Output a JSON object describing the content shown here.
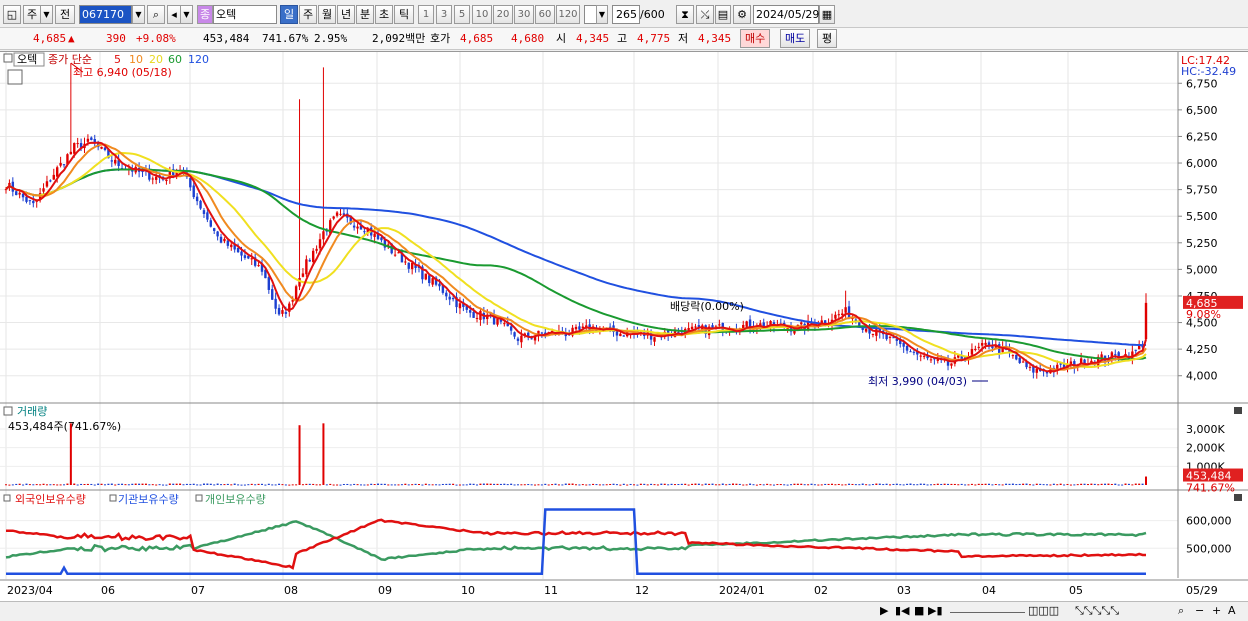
{
  "toolbar": {
    "market_btn": "주",
    "prev_btn": "전",
    "code": "067170",
    "name_tag": "종",
    "name": "오텍",
    "periods": [
      "일",
      "주",
      "월",
      "년",
      "분",
      "초",
      "틱"
    ],
    "active_period": "일",
    "intervals": [
      "1",
      "3",
      "5",
      "10",
      "20",
      "30",
      "60",
      "120"
    ],
    "count": "265",
    "count_total": "/600",
    "date": "2024/05/29"
  },
  "quote": {
    "price": "4,685",
    "arrow": "▲",
    "change": "390",
    "change_pct": "+9.08%",
    "volume": "453,484",
    "volume_pct": "741.67%",
    "turnover_pct": "2.95%",
    "amount": "2,092백만",
    "bid_label": "호가",
    "bid1": "4,685",
    "bid2": "4,680",
    "open_label": "시",
    "open": "4,345",
    "high_label": "고",
    "high": "4,775",
    "low_label": "저",
    "low": "4,345",
    "buy_btn": "매수",
    "sell_btn": "매도",
    "extra_btn": "평"
  },
  "colors": {
    "up": "#e00000",
    "down": "#1c3fd0",
    "ma5": "#e01010",
    "ma10": "#f08a20",
    "ma20": "#f0e020",
    "ma60": "#1a9a30",
    "ma120": "#2050e0",
    "foreign": "#e01010",
    "inst": "#2050e0",
    "indiv": "#3a9a60"
  },
  "chart_data": [
    {
      "type": "candlestick",
      "title": "오텍",
      "legend": [
        "종가 단순",
        "5",
        "10",
        "20",
        "60",
        "120"
      ],
      "x_ticks": [
        "2023/04",
        "06",
        "07",
        "08",
        "09",
        "10",
        "11",
        "12",
        "2024/01",
        "02",
        "03",
        "04",
        "05",
        "05/29"
      ],
      "ylim": [
        3800,
        6950
      ],
      "y_ticks": [
        "6,750",
        "6,500",
        "6,250",
        "6,000",
        "5,750",
        "5,500",
        "5,250",
        "5,000",
        "4,750",
        "4,500",
        "4,250",
        "4,000"
      ],
      "anchors": [
        {
          "x": 0,
          "y": 5800
        },
        {
          "x": 8,
          "y": 5600
        },
        {
          "x": 14,
          "y": 5900
        },
        {
          "x": 20,
          "y": 6150
        },
        {
          "x": 25,
          "y": 6200
        },
        {
          "x": 32,
          "y": 6000
        },
        {
          "x": 40,
          "y": 5900
        },
        {
          "x": 46,
          "y": 5850
        },
        {
          "x": 51,
          "y": 5950
        },
        {
          "x": 56,
          "y": 5650
        },
        {
          "x": 62,
          "y": 5300
        },
        {
          "x": 68,
          "y": 5150
        },
        {
          "x": 75,
          "y": 5000
        },
        {
          "x": 80,
          "y": 4550
        },
        {
          "x": 83,
          "y": 4650
        },
        {
          "x": 86,
          "y": 4950
        },
        {
          "x": 89,
          "y": 5100
        },
        {
          "x": 93,
          "y": 5350
        },
        {
          "x": 97,
          "y": 5500
        },
        {
          "x": 105,
          "y": 5400
        },
        {
          "x": 112,
          "y": 5200
        },
        {
          "x": 120,
          "y": 5000
        },
        {
          "x": 128,
          "y": 4800
        },
        {
          "x": 135,
          "y": 4600
        },
        {
          "x": 142,
          "y": 4550
        },
        {
          "x": 150,
          "y": 4350
        },
        {
          "x": 158,
          "y": 4400
        },
        {
          "x": 165,
          "y": 4400
        },
        {
          "x": 172,
          "y": 4450
        },
        {
          "x": 180,
          "y": 4400
        },
        {
          "x": 190,
          "y": 4380
        },
        {
          "x": 200,
          "y": 4420
        },
        {
          "x": 210,
          "y": 4450
        },
        {
          "x": 220,
          "y": 4480
        },
        {
          "x": 232,
          "y": 4450
        },
        {
          "x": 240,
          "y": 4520
        },
        {
          "x": 246,
          "y": 4600
        },
        {
          "x": 252,
          "y": 4450
        },
        {
          "x": 258,
          "y": 4350
        },
        {
          "x": 264,
          "y": 4250
        },
        {
          "x": 270,
          "y": 4150
        },
        {
          "x": 276,
          "y": 4100
        },
        {
          "x": 282,
          "y": 4200
        },
        {
          "x": 288,
          "y": 4300
        },
        {
          "x": 294,
          "y": 4200
        },
        {
          "x": 300,
          "y": 4050
        },
        {
          "x": 306,
          "y": 4050
        },
        {
          "x": 312,
          "y": 4100
        },
        {
          "x": 318,
          "y": 4150
        },
        {
          "x": 324,
          "y": 4180
        },
        {
          "x": 330,
          "y": 4200
        },
        {
          "x": 333,
          "y": 4300
        },
        {
          "x": 334,
          "y": 4685
        }
      ],
      "spikes": [
        {
          "x": 19,
          "y": 6940
        },
        {
          "x": 86,
          "y": 6600
        },
        {
          "x": 93,
          "y": 6900
        },
        {
          "x": 246,
          "y": 4800
        },
        {
          "x": 334,
          "y": 4775
        }
      ],
      "annotations": [
        "최고 6,940 (05/18)",
        "최저 3,990 (04/03)",
        "배당락(0.00%)"
      ],
      "right_labels": {
        "lc": "LC:17.42",
        "hc": "HC:-32.49",
        "price": "4,685",
        "pct": "9.08%"
      }
    },
    {
      "type": "bar",
      "title": "거래량",
      "info": "453,484주(741.67%)",
      "y_ticks": [
        "3,000K",
        "2,000K",
        "1,000K"
      ],
      "ylim": [
        0,
        3800000
      ],
      "spikes": [
        {
          "x": 19,
          "v": 3300000
        },
        {
          "x": 86,
          "v": 3200000
        },
        {
          "x": 93,
          "v": 3300000
        },
        {
          "x": 334,
          "v": 453484
        }
      ],
      "right_labels": {
        "volume": "453,484",
        "pct": "741.67%"
      }
    },
    {
      "type": "line",
      "series_labels": [
        "외국인보유수량",
        "기관보유수량",
        "개인보유수량"
      ],
      "y_ticks": [
        "600,000",
        "500,000"
      ],
      "ylim": [
        400000,
        660000
      ]
    }
  ],
  "bottom": {
    "date_label": "05/29"
  }
}
